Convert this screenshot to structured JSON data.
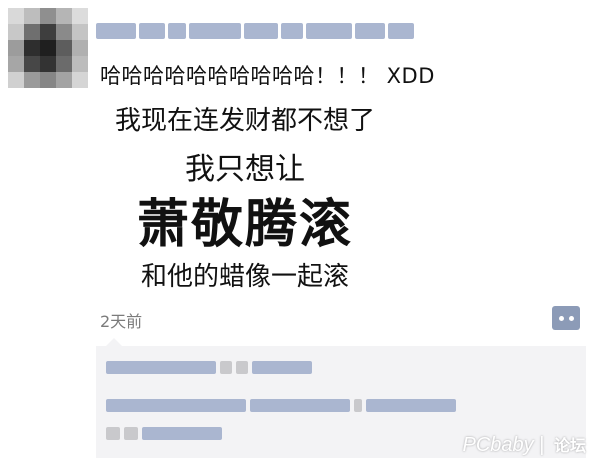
{
  "post": {
    "text": "哈哈哈哈哈哈哈哈哈哈！！！ XDD",
    "image_lines": [
      "我现在连发财都不想了",
      "我只想让",
      "萧敬腾滚",
      "和他的蜡像一起滚"
    ],
    "timestamp": "2天前"
  },
  "watermark": {
    "logo": "PCbaby",
    "forum": "论坛"
  }
}
